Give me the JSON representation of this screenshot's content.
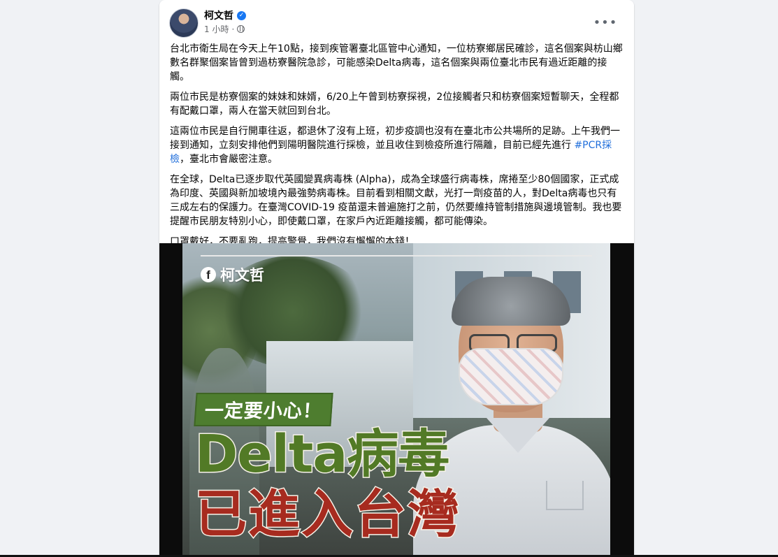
{
  "post": {
    "author": "柯文哲",
    "timestamp": "1 小時",
    "more_label": "•••",
    "paragraphs": [
      "台北市衛生局在今天上午10點，接到疾管署臺北區管中心通知，一位枋寮鄉居民確診，這名個案與枋山鄉數名群聚個案皆曾到過枋寮醫院急診，可能感染Delta病毒，這名個案與兩位臺北市民有過近距離的接觸。",
      "兩位市民是枋寮個案的妹妹和妹婿，6/20上午曾到枋寮探視，2位接觸者只和枋寮個案短暫聊天，全程都有配戴口罩，兩人在當天就回到台北。",
      "在全球，Delta已逐步取代英國變異病毒株 (Alpha)，成為全球盛行病毒株，席捲至少80個國家，正式成為印度、英國與新加坡境內最強勢病毒株。目前看到相關文獻，光打一劑疫苗的人，對Delta病毒也只有三成左右的保護力。在臺灣COVID-19 疫苗還未普遍施打之前，仍然要維持管制措施與邊境管制。我也要提醒市民朋友特別小心，即使戴口罩，在家戶內近距離接觸，都可能傳染。",
      "口罩戴好，不要亂跑，提高警覺，我們沒有懈懈的本錢！"
    ],
    "paragraph3_before": "這兩位市民是自行開車往返，都退休了沒有上班，初步疫調也沒有在臺北市公共場所的足跡。上午我們一接到通知，立刻安排他們到陽明醫院進行採檢，並且收住到檢疫所進行隔離，目前已經先進行 ",
    "paragraph3_hashtag": "#PCR採檢",
    "paragraph3_after": "，臺北市會嚴密注意。"
  },
  "poster": {
    "fb_letter": "f",
    "fb_name": "柯文哲",
    "caption": "一定要小心！",
    "headline_line1": "Delta病毒",
    "headline_line2": "已進入台灣"
  },
  "colors": {
    "hashtag": "#216fdb",
    "caption_bg": "#4e7d2f",
    "headline1": "#527a26",
    "headline2": "#a72b1f",
    "verified": "#1877f2"
  },
  "icons": {
    "verified": "verified-badge-icon",
    "privacy": "globe-icon",
    "more": "more-options-icon"
  }
}
